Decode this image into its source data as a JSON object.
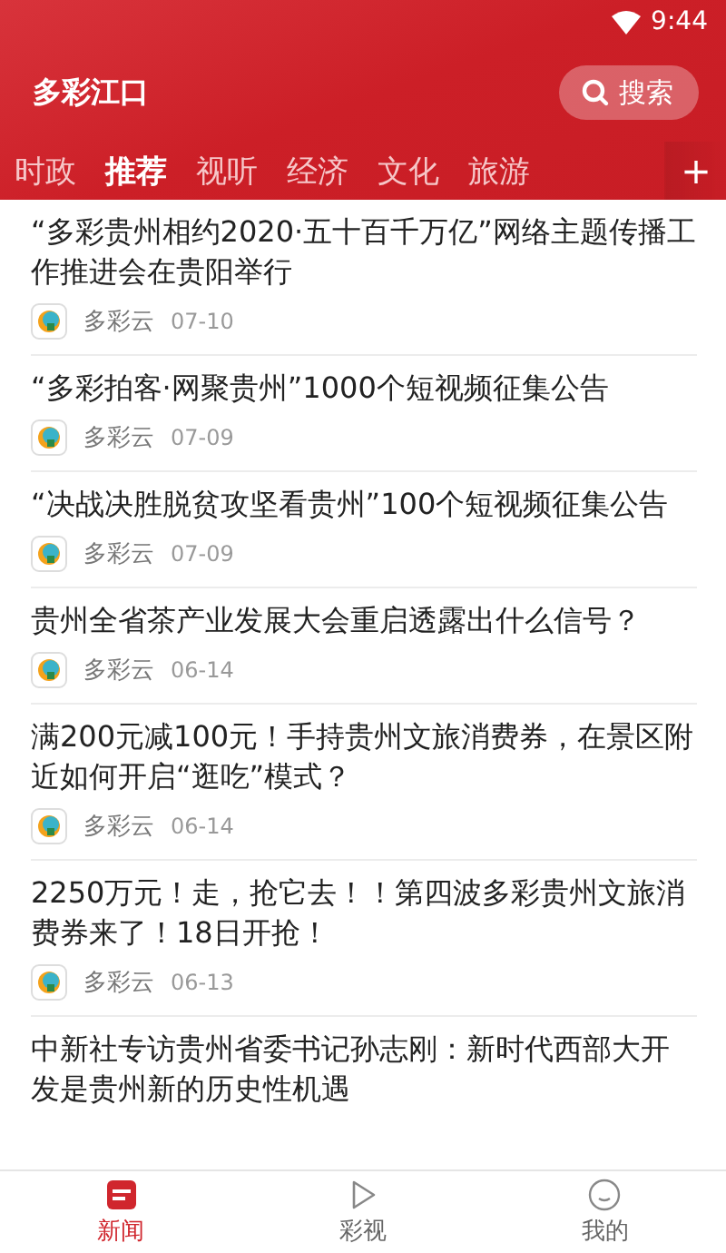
{
  "status_bar": {
    "time": "9:44"
  },
  "header": {
    "title": "多彩江口",
    "search_label": "搜索"
  },
  "tabs": [
    {
      "label": "时政",
      "selected": false
    },
    {
      "label": "推荐",
      "selected": true
    },
    {
      "label": "视听",
      "selected": false
    },
    {
      "label": "经济",
      "selected": false
    },
    {
      "label": "文化",
      "selected": false
    },
    {
      "label": "旅游",
      "selected": false
    }
  ],
  "add_tab": "+",
  "articles": [
    {
      "title": "“多彩贵州相约2020·五十百千万亿”网络主题传播工作推进会在贵阳举行",
      "source": "多彩云",
      "date": "07-10"
    },
    {
      "title": "“多彩拍客·网聚贵州”1000个短视频征集公告",
      "source": "多彩云",
      "date": "07-09"
    },
    {
      "title": "“决战决胜脱贫攻坚看贵州”100个短视频征集公告",
      "source": "多彩云",
      "date": "07-09"
    },
    {
      "title": "贵州全省茶产业发展大会重启透露出什么信号？",
      "source": "多彩云",
      "date": "06-14"
    },
    {
      "title": "满200元减100元！手持贵州文旅消费券，在景区附近如何开启“逛吃”模式？",
      "source": "多彩云",
      "date": "06-14"
    },
    {
      "title": "2250万元！走，抢它去！！第四波多彩贵州文旅消费券来了！18日开抢！",
      "source": "多彩云",
      "date": "06-13"
    },
    {
      "title": "中新社专访贵州省委书记孙志刚：新时代西部大开发是贵州新的历史性机遇"
    }
  ],
  "bottom_nav": [
    {
      "label": "新闻",
      "kind": "news",
      "selected": true
    },
    {
      "label": "彩视",
      "kind": "video",
      "selected": false
    },
    {
      "label": "我的",
      "kind": "profile",
      "selected": false
    }
  ]
}
